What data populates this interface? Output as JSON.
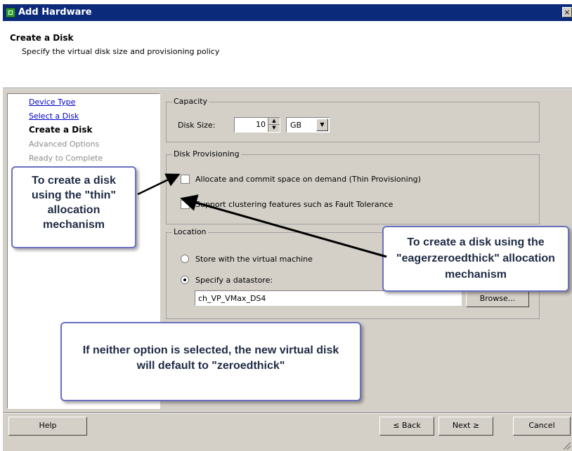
{
  "window": {
    "title": "Add Hardware",
    "close_glyph": "×"
  },
  "header": {
    "title": "Create a Disk",
    "subtitle": "Specify the virtual disk size and provisioning policy"
  },
  "sidebar": {
    "items": [
      {
        "label": "Device Type",
        "state": "link"
      },
      {
        "label": "Select a Disk",
        "state": "link"
      },
      {
        "label": "Create a Disk",
        "state": "current"
      },
      {
        "label": "Advanced Options",
        "state": "disabled"
      },
      {
        "label": "Ready to Complete",
        "state": "disabled"
      }
    ]
  },
  "capacity": {
    "group_label": "Capacity",
    "disk_size_label": "Disk Size:",
    "disk_size_value": "10",
    "unit": "GB"
  },
  "provisioning": {
    "group_label": "Disk Provisioning",
    "thin_label": "Allocate and commit space on demand (Thin Provisioning)",
    "thin_checked": false,
    "cluster_label": "Support clustering features such as Fault Tolerance",
    "cluster_checked": false
  },
  "location": {
    "group_label": "Location",
    "store_with_vm_label": "Store with the virtual machine",
    "store_with_vm_selected": false,
    "specify_datastore_label": "Specify a datastore:",
    "specify_datastore_selected": true,
    "datastore_value": "ch_VP_VMax_DS4",
    "browse_label": "Browse..."
  },
  "annotations": {
    "thin": "To create a disk using the \"thin\" allocation mechanism",
    "eager": "To create a disk using the \"eagerzeroedthick\" allocation mechanism",
    "default": "If neither option is selected, the new virtual disk will default to \"zeroedthick\""
  },
  "footer": {
    "help_label": "Help",
    "back_label": "≤ Back",
    "next_label": "Next ≥",
    "cancel_label": "Cancel"
  },
  "colors": {
    "titlebar": "#0c2a7a",
    "callout_border": "#6a6fc0",
    "link": "#0000cc"
  }
}
